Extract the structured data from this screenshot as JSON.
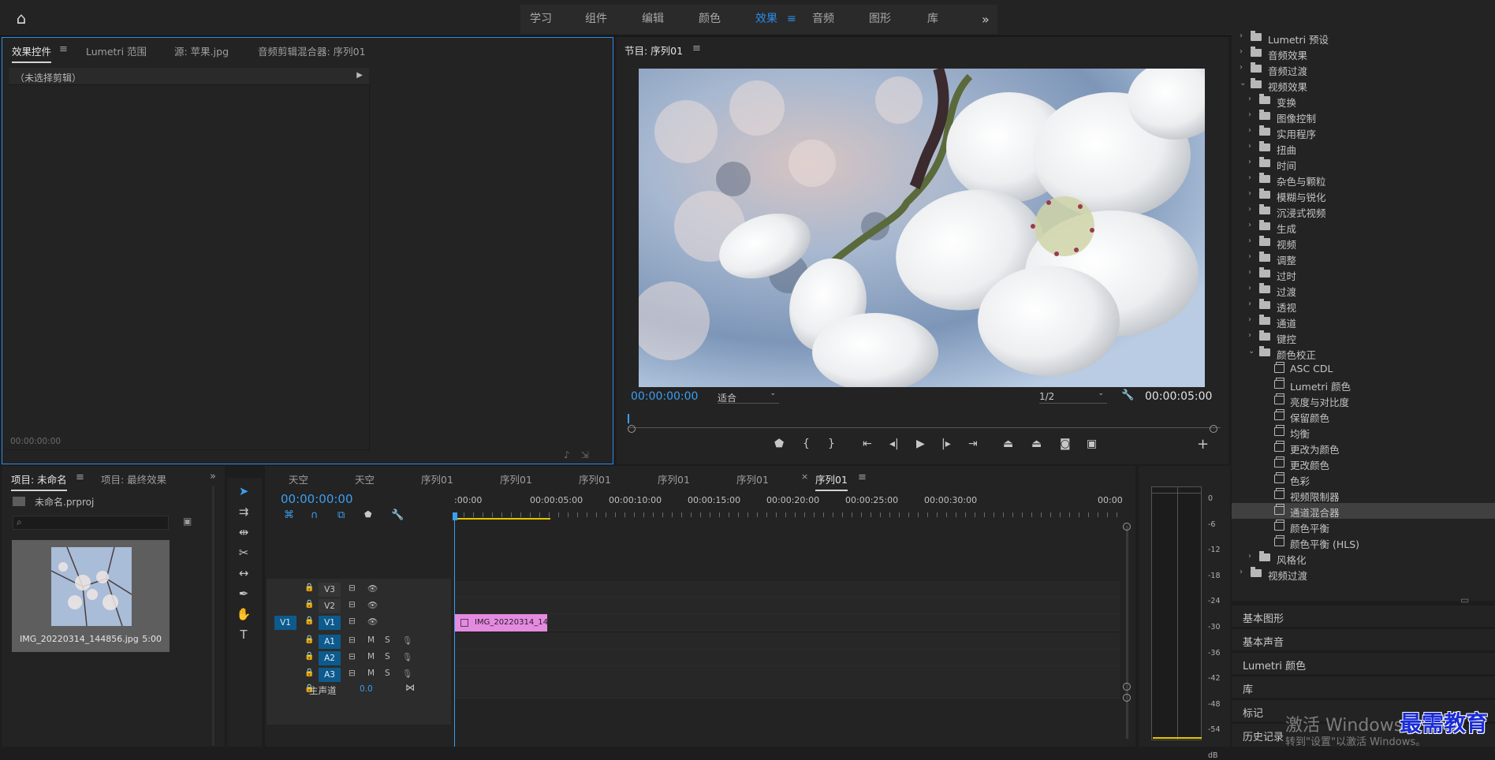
{
  "nav": {
    "items": [
      {
        "label": "学习"
      },
      {
        "label": "组件"
      },
      {
        "label": "编辑"
      },
      {
        "label": "颜色"
      },
      {
        "label": "效果",
        "active": true
      },
      {
        "label": "音频"
      },
      {
        "label": "图形"
      },
      {
        "label": "库"
      }
    ],
    "more": "»"
  },
  "effect_controls": {
    "tabs": [
      "效果控件",
      "Lumetri 范围",
      "源: 苹果.jpg",
      "音频剪辑混合器: 序列01"
    ],
    "no_clip": "（未选择剪辑）",
    "timecode": "00:00:00:00"
  },
  "program_monitor": {
    "tab": "节目: 序列01",
    "timecode": "00:00:00:00",
    "fit": "适合",
    "resolution": "1/2",
    "duration": "00:00:05:00"
  },
  "effects": {
    "tree": [
      {
        "label": "Lumetri 预设",
        "level": 0,
        "expanded": false
      },
      {
        "label": "音频效果",
        "level": 0,
        "expanded": false
      },
      {
        "label": "音频过渡",
        "level": 0,
        "expanded": false
      },
      {
        "label": "视频效果",
        "level": 0,
        "expanded": true
      },
      {
        "label": "变换",
        "level": 1,
        "expanded": false
      },
      {
        "label": "图像控制",
        "level": 1,
        "expanded": false
      },
      {
        "label": "实用程序",
        "level": 1,
        "expanded": false
      },
      {
        "label": "扭曲",
        "level": 1,
        "expanded": false
      },
      {
        "label": "时间",
        "level": 1,
        "expanded": false
      },
      {
        "label": "杂色与颗粒",
        "level": 1,
        "expanded": false
      },
      {
        "label": "模糊与锐化",
        "level": 1,
        "expanded": false
      },
      {
        "label": "沉浸式视频",
        "level": 1,
        "expanded": false
      },
      {
        "label": "生成",
        "level": 1,
        "expanded": false
      },
      {
        "label": "视频",
        "level": 1,
        "expanded": false
      },
      {
        "label": "调整",
        "level": 1,
        "expanded": false
      },
      {
        "label": "过时",
        "level": 1,
        "expanded": false
      },
      {
        "label": "过渡",
        "level": 1,
        "expanded": false
      },
      {
        "label": "透视",
        "level": 1,
        "expanded": false
      },
      {
        "label": "通道",
        "level": 1,
        "expanded": false
      },
      {
        "label": "键控",
        "level": 1,
        "expanded": false
      },
      {
        "label": "颜色校正",
        "level": 1,
        "expanded": true
      },
      {
        "label": "ASC CDL",
        "level": 2,
        "effect": true
      },
      {
        "label": "Lumetri 颜色",
        "level": 2,
        "effect": true
      },
      {
        "label": "亮度与对比度",
        "level": 2,
        "effect": true
      },
      {
        "label": "保留颜色",
        "level": 2,
        "effect": true
      },
      {
        "label": "均衡",
        "level": 2,
        "effect": true
      },
      {
        "label": "更改为颜色",
        "level": 2,
        "effect": true
      },
      {
        "label": "更改颜色",
        "level": 2,
        "effect": true
      },
      {
        "label": "色彩",
        "level": 2,
        "effect": true
      },
      {
        "label": "视频限制器",
        "level": 2,
        "effect": true
      },
      {
        "label": "通道混合器",
        "level": 2,
        "effect": true,
        "selected": true
      },
      {
        "label": "颜色平衡",
        "level": 2,
        "effect": true
      },
      {
        "label": "颜色平衡 (HLS)",
        "level": 2,
        "effect": true
      },
      {
        "label": "风格化",
        "level": 1,
        "expanded": false
      },
      {
        "label": "视频过渡",
        "level": 0,
        "expanded": false
      }
    ]
  },
  "side_panels": [
    "基本图形",
    "基本声音",
    "Lumetri 颜色",
    "库",
    "标记",
    "历史记录"
  ],
  "project": {
    "tabs": [
      "项目: 未命名",
      "项目: 最终效果"
    ],
    "file": "未命名.prproj",
    "item_name": "IMG_20220314_144856.jpg",
    "item_duration": "5:00"
  },
  "timeline": {
    "tabs": [
      "天空",
      "天空",
      "序列01",
      "序列01",
      "序列01",
      "序列01",
      "序列01",
      "序列01"
    ],
    "timecode": "00:00:00:00",
    "ruler": [
      ":00:00",
      "00:00:05:00",
      "00:00:10:00",
      "00:00:15:00",
      "00:00:20:00",
      "00:00:25:00",
      "00:00:30:00",
      "00:00"
    ],
    "video_tracks": [
      "V3",
      "V2",
      "V1"
    ],
    "source_track": "V1",
    "audio_tracks": [
      "A1",
      "A2",
      "A3"
    ],
    "mute": "M",
    "solo": "S",
    "master": "主声道",
    "master_value": "0.0",
    "clip": "IMG_20220314_1448"
  },
  "meters": {
    "db_labels": [
      "0",
      "-6",
      "-12",
      "-18",
      "-24",
      "-30",
      "-36",
      "-42",
      "-48",
      "-54",
      "dB"
    ]
  },
  "watermark": {
    "line1": "激活 Windows",
    "line2": "转到\"设置\"以激活 Windows。",
    "brand": "最需教育"
  },
  "colors": {
    "accent": "#2d8ceb",
    "clip": "#e48be0",
    "workarea": "#e5c600"
  }
}
